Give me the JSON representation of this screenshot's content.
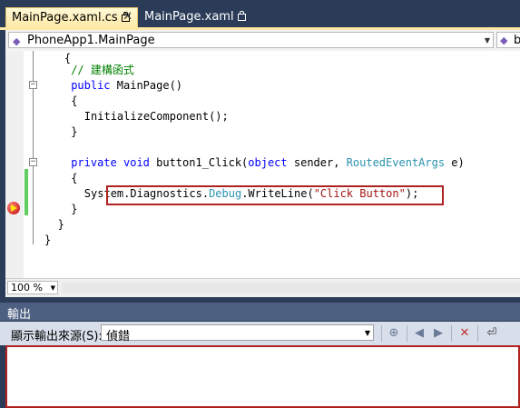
{
  "tabs": [
    {
      "label": "MainPage.xaml.cs",
      "active": true,
      "locked": true,
      "close": "✕"
    },
    {
      "label": "MainPage.xaml",
      "active": false,
      "locked": true
    }
  ],
  "navbar": {
    "class_combo": "PhoneApp1.MainPage",
    "member_combo": "b"
  },
  "editor": {
    "lines": [
      {
        "segments": [
          {
            "t": "{",
            "c": ""
          }
        ]
      },
      {
        "segments": [
          {
            "t": "// 建構函式",
            "c": "cm"
          }
        ]
      },
      {
        "segments": [
          {
            "t": "public",
            "c": "kw"
          },
          {
            "t": " MainPage()",
            "c": ""
          }
        ]
      },
      {
        "segments": [
          {
            "t": "{",
            "c": ""
          }
        ]
      },
      {
        "segments": [
          {
            "t": "InitializeComponent();",
            "c": ""
          }
        ]
      },
      {
        "segments": [
          {
            "t": "}",
            "c": ""
          }
        ]
      },
      {
        "segments": []
      },
      {
        "segments": [
          {
            "t": "private",
            "c": "kw"
          },
          {
            "t": " ",
            "c": ""
          },
          {
            "t": "void",
            "c": "kw"
          },
          {
            "t": " button1_Click(",
            "c": ""
          },
          {
            "t": "object",
            "c": "kw"
          },
          {
            "t": " sender, ",
            "c": ""
          },
          {
            "t": "RoutedEventArgs",
            "c": "ty"
          },
          {
            "t": " e)",
            "c": ""
          }
        ]
      },
      {
        "segments": [
          {
            "t": "{",
            "c": ""
          }
        ]
      },
      {
        "segments": [
          {
            "t": "System.Diagnostics.",
            "c": ""
          },
          {
            "t": "Debug",
            "c": "ty"
          },
          {
            "t": ".WriteLine(",
            "c": ""
          },
          {
            "t": "\"Click Button\"",
            "c": "st"
          },
          {
            "t": ");",
            "c": ""
          }
        ]
      },
      {
        "segments": [
          {
            "t": "}",
            "c": ""
          }
        ]
      },
      {
        "segments": [
          {
            "t": "}",
            "c": ""
          }
        ]
      },
      {
        "segments": [
          {
            "t": "}",
            "c": ""
          }
        ]
      }
    ]
  },
  "status": {
    "zoom": "100 %"
  },
  "output": {
    "title": "輸出",
    "source_label": "顯示輸出來源(S):",
    "source_value": "偵錯"
  }
}
